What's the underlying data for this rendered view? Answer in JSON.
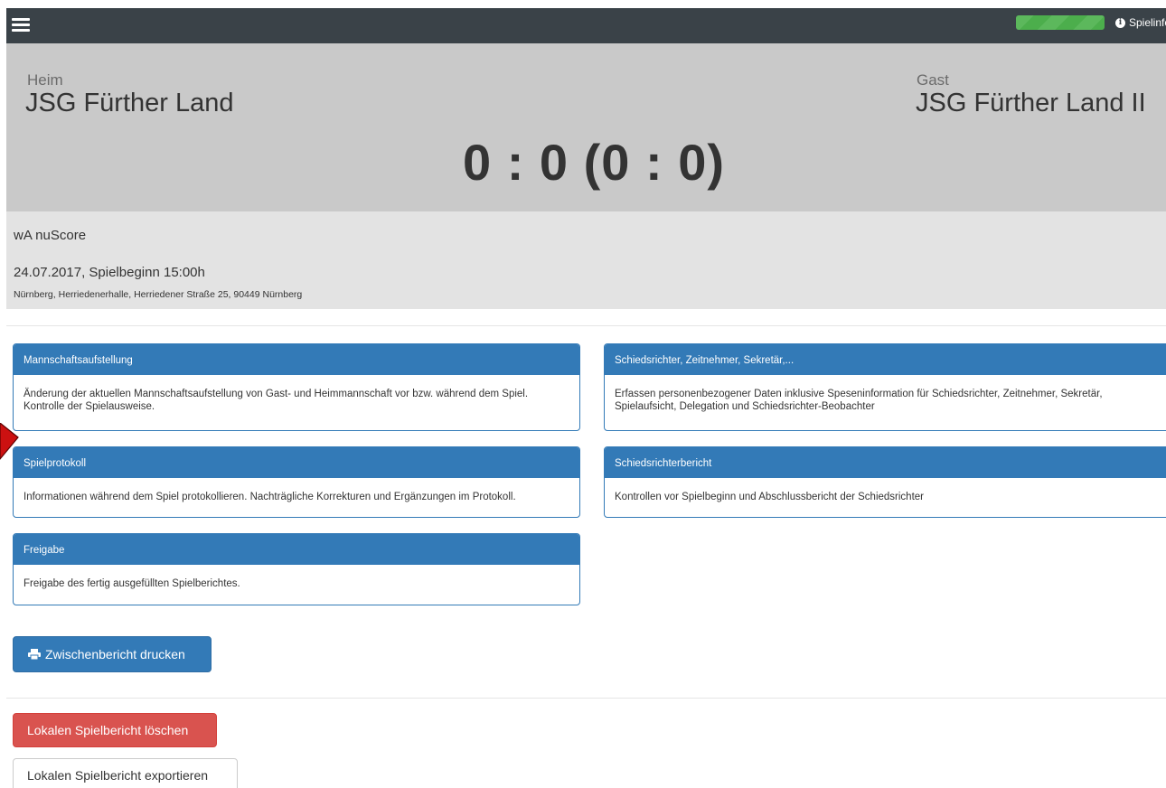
{
  "navbar": {
    "menu_icon": "hamburger-menu-icon",
    "progress_color": "#5cb85c",
    "info_icon": "info-circle-icon",
    "info_label": "Spielinfo"
  },
  "match": {
    "home_label": "Heim",
    "home_team": "JSG Fürther Land",
    "away_label": "Gast",
    "away_team": "JSG Fürther Land II",
    "score": "0 : 0 (0 : 0)",
    "competition": "wA nuScore",
    "date_time": "24.07.2017, Spielbeginn 15:00h",
    "venue": "Nürnberg, Herriedenerhalle, Herriedener Straße 25, 90449 Nürnberg"
  },
  "panels": {
    "lineup": {
      "title": "Mannschaftsaufstellung",
      "body": "Änderung der aktuellen Mannschaftsaufstellung von Gast- und Heimmannschaft vor bzw. während dem Spiel. Kontrolle der Spielausweise."
    },
    "officials": {
      "title": "Schiedsrichter, Zeitnehmer, Sekretär,...",
      "body": "Erfassen personenbezogener Daten inklusive Speseninformation für Schiedsrichter, Zeitnehmer, Sekretär, Spielaufsicht, Delegation und Schiedsrichter-Beobachter"
    },
    "protocol": {
      "title": "Spielprotokoll",
      "body": "Informationen während dem Spiel protokollieren. Nachträgliche Korrekturen und Ergänzungen im Protokoll."
    },
    "referee_report": {
      "title": "Schiedsrichterbericht",
      "body": "Kontrollen vor Spielbeginn und Abschlussbericht der Schiedsrichter"
    },
    "release": {
      "title": "Freigabe",
      "body": "Freigabe des fertig ausgefüllten Spielberichtes."
    }
  },
  "buttons": {
    "print_icon": "print-icon",
    "print_label": "Zwischenbericht drucken",
    "delete_label": "Lokalen Spielbericht löschen",
    "export_label": "Lokalen Spielbericht exportieren"
  },
  "colors": {
    "navbar": "#3a4248",
    "primary": "#337ab7",
    "danger": "#d9534f",
    "annotation_arrow": "#cc1111"
  }
}
